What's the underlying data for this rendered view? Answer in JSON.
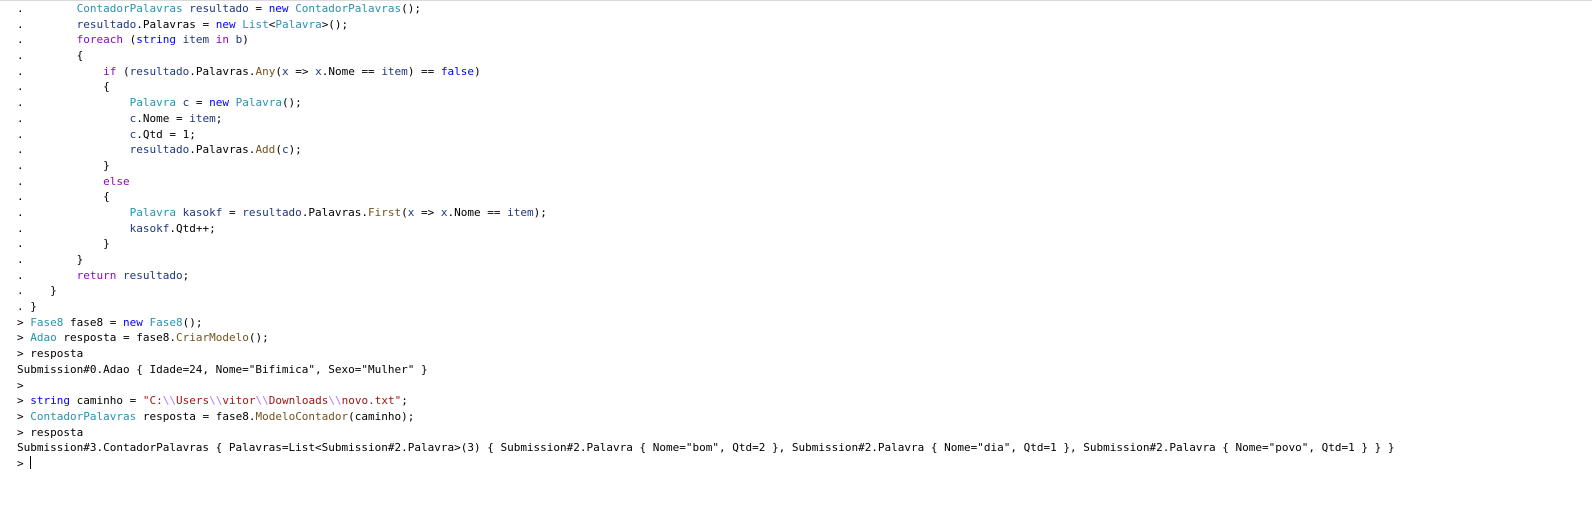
{
  "window": {
    "accent_colors": {
      "keyword": "#0000ff",
      "control_keyword": "#8f08c4",
      "type": "#2b91af",
      "method": "#74531f",
      "parameter": "#1f377f",
      "string": "#a31515",
      "escape": "#b776fb"
    }
  },
  "console": {
    "lines": [
      {
        "kind": "code",
        "tokens": [
          {
            "t": ".",
            "c": "plain"
          },
          {
            "t": "        ",
            "c": "plain"
          },
          {
            "t": "ContadorPalavras",
            "c": "type"
          },
          {
            "t": " ",
            "c": "plain"
          },
          {
            "t": "resultado",
            "c": "param"
          },
          {
            "t": " = ",
            "c": "op"
          },
          {
            "t": "new",
            "c": "kw"
          },
          {
            "t": " ",
            "c": "plain"
          },
          {
            "t": "ContadorPalavras",
            "c": "type"
          },
          {
            "t": "();",
            "c": "op"
          }
        ]
      },
      {
        "kind": "code",
        "tokens": [
          {
            "t": ".",
            "c": "plain"
          },
          {
            "t": "        ",
            "c": "plain"
          },
          {
            "t": "resultado",
            "c": "param"
          },
          {
            "t": ".Palavras = ",
            "c": "op"
          },
          {
            "t": "new",
            "c": "kw"
          },
          {
            "t": " ",
            "c": "plain"
          },
          {
            "t": "List",
            "c": "type"
          },
          {
            "t": "<",
            "c": "op"
          },
          {
            "t": "Palavra",
            "c": "type"
          },
          {
            "t": ">();",
            "c": "op"
          }
        ]
      },
      {
        "kind": "code",
        "tokens": [
          {
            "t": ".",
            "c": "plain"
          },
          {
            "t": "        ",
            "c": "plain"
          },
          {
            "t": "foreach",
            "c": "ctl"
          },
          {
            "t": " (",
            "c": "op"
          },
          {
            "t": "string",
            "c": "kw"
          },
          {
            "t": " ",
            "c": "plain"
          },
          {
            "t": "item",
            "c": "param"
          },
          {
            "t": " ",
            "c": "plain"
          },
          {
            "t": "in",
            "c": "ctl"
          },
          {
            "t": " ",
            "c": "plain"
          },
          {
            "t": "b",
            "c": "param"
          },
          {
            "t": ")",
            "c": "op"
          }
        ]
      },
      {
        "kind": "code",
        "tokens": [
          {
            "t": ".",
            "c": "plain"
          },
          {
            "t": "        {",
            "c": "op"
          }
        ]
      },
      {
        "kind": "code",
        "tokens": [
          {
            "t": ".",
            "c": "plain"
          },
          {
            "t": "            ",
            "c": "plain"
          },
          {
            "t": "if",
            "c": "ctl"
          },
          {
            "t": " (",
            "c": "op"
          },
          {
            "t": "resultado",
            "c": "param"
          },
          {
            "t": ".Palavras.",
            "c": "op"
          },
          {
            "t": "Any",
            "c": "method"
          },
          {
            "t": "(",
            "c": "op"
          },
          {
            "t": "x",
            "c": "param"
          },
          {
            "t": " => ",
            "c": "op"
          },
          {
            "t": "x",
            "c": "param"
          },
          {
            "t": ".Nome == ",
            "c": "op"
          },
          {
            "t": "item",
            "c": "param"
          },
          {
            "t": ") == ",
            "c": "op"
          },
          {
            "t": "false",
            "c": "kw"
          },
          {
            "t": ")",
            "c": "op"
          }
        ]
      },
      {
        "kind": "code",
        "tokens": [
          {
            "t": ".",
            "c": "plain"
          },
          {
            "t": "            {",
            "c": "op"
          }
        ]
      },
      {
        "kind": "code",
        "tokens": [
          {
            "t": ".",
            "c": "plain"
          },
          {
            "t": "                ",
            "c": "plain"
          },
          {
            "t": "Palavra",
            "c": "type"
          },
          {
            "t": " ",
            "c": "plain"
          },
          {
            "t": "c",
            "c": "param"
          },
          {
            "t": " = ",
            "c": "op"
          },
          {
            "t": "new",
            "c": "kw"
          },
          {
            "t": " ",
            "c": "plain"
          },
          {
            "t": "Palavra",
            "c": "type"
          },
          {
            "t": "();",
            "c": "op"
          }
        ]
      },
      {
        "kind": "code",
        "tokens": [
          {
            "t": ".",
            "c": "plain"
          },
          {
            "t": "                ",
            "c": "plain"
          },
          {
            "t": "c",
            "c": "param"
          },
          {
            "t": ".Nome = ",
            "c": "op"
          },
          {
            "t": "item",
            "c": "param"
          },
          {
            "t": ";",
            "c": "op"
          }
        ]
      },
      {
        "kind": "code",
        "tokens": [
          {
            "t": ".",
            "c": "plain"
          },
          {
            "t": "                ",
            "c": "plain"
          },
          {
            "t": "c",
            "c": "param"
          },
          {
            "t": ".Qtd = 1;",
            "c": "op"
          }
        ]
      },
      {
        "kind": "code",
        "tokens": [
          {
            "t": ".",
            "c": "plain"
          },
          {
            "t": "                ",
            "c": "plain"
          },
          {
            "t": "resultado",
            "c": "param"
          },
          {
            "t": ".Palavras.",
            "c": "op"
          },
          {
            "t": "Add",
            "c": "method"
          },
          {
            "t": "(",
            "c": "op"
          },
          {
            "t": "c",
            "c": "param"
          },
          {
            "t": ");",
            "c": "op"
          }
        ]
      },
      {
        "kind": "code",
        "tokens": [
          {
            "t": ".",
            "c": "plain"
          },
          {
            "t": "            }",
            "c": "op"
          }
        ]
      },
      {
        "kind": "code",
        "tokens": [
          {
            "t": ".",
            "c": "plain"
          },
          {
            "t": "            ",
            "c": "plain"
          },
          {
            "t": "else",
            "c": "ctl"
          }
        ]
      },
      {
        "kind": "code",
        "tokens": [
          {
            "t": ".",
            "c": "plain"
          },
          {
            "t": "            {",
            "c": "op"
          }
        ]
      },
      {
        "kind": "code",
        "tokens": [
          {
            "t": ".",
            "c": "plain"
          },
          {
            "t": "                ",
            "c": "plain"
          },
          {
            "t": "Palavra",
            "c": "type"
          },
          {
            "t": " ",
            "c": "plain"
          },
          {
            "t": "kasokf",
            "c": "param"
          },
          {
            "t": " = ",
            "c": "op"
          },
          {
            "t": "resultado",
            "c": "param"
          },
          {
            "t": ".Palavras.",
            "c": "op"
          },
          {
            "t": "First",
            "c": "method"
          },
          {
            "t": "(",
            "c": "op"
          },
          {
            "t": "x",
            "c": "param"
          },
          {
            "t": " => ",
            "c": "op"
          },
          {
            "t": "x",
            "c": "param"
          },
          {
            "t": ".Nome == ",
            "c": "op"
          },
          {
            "t": "item",
            "c": "param"
          },
          {
            "t": ");",
            "c": "op"
          }
        ]
      },
      {
        "kind": "code",
        "tokens": [
          {
            "t": ".",
            "c": "plain"
          },
          {
            "t": "                ",
            "c": "plain"
          },
          {
            "t": "kasokf",
            "c": "param"
          },
          {
            "t": ".Qtd++;",
            "c": "op"
          }
        ]
      },
      {
        "kind": "code",
        "tokens": [
          {
            "t": ".",
            "c": "plain"
          },
          {
            "t": "            }",
            "c": "op"
          }
        ]
      },
      {
        "kind": "code",
        "tokens": [
          {
            "t": ".",
            "c": "plain"
          },
          {
            "t": "        }",
            "c": "op"
          }
        ]
      },
      {
        "kind": "code",
        "tokens": [
          {
            "t": ".",
            "c": "plain"
          },
          {
            "t": "        ",
            "c": "plain"
          },
          {
            "t": "return",
            "c": "ctl"
          },
          {
            "t": " ",
            "c": "plain"
          },
          {
            "t": "resultado",
            "c": "param"
          },
          {
            "t": ";",
            "c": "op"
          }
        ]
      },
      {
        "kind": "code",
        "tokens": [
          {
            "t": ".",
            "c": "plain"
          },
          {
            "t": "    }",
            "c": "op"
          }
        ]
      },
      {
        "kind": "code",
        "tokens": [
          {
            "t": ". }",
            "c": "op"
          }
        ]
      },
      {
        "kind": "input",
        "tokens": [
          {
            "t": "> ",
            "c": "plain"
          },
          {
            "t": "Fase8",
            "c": "type"
          },
          {
            "t": " ",
            "c": "plain"
          },
          {
            "t": "fase8",
            "c": "plain"
          },
          {
            "t": " = ",
            "c": "op"
          },
          {
            "t": "new",
            "c": "kw"
          },
          {
            "t": " ",
            "c": "plain"
          },
          {
            "t": "Fase8",
            "c": "type"
          },
          {
            "t": "();",
            "c": "op"
          }
        ]
      },
      {
        "kind": "input",
        "tokens": [
          {
            "t": "> ",
            "c": "plain"
          },
          {
            "t": "Adao",
            "c": "type"
          },
          {
            "t": " ",
            "c": "plain"
          },
          {
            "t": "resposta",
            "c": "plain"
          },
          {
            "t": " = ",
            "c": "op"
          },
          {
            "t": "fase8",
            "c": "plain"
          },
          {
            "t": ".",
            "c": "op"
          },
          {
            "t": "CriarModelo",
            "c": "method"
          },
          {
            "t": "();",
            "c": "op"
          }
        ]
      },
      {
        "kind": "input",
        "tokens": [
          {
            "t": "> ",
            "c": "plain"
          },
          {
            "t": "resposta",
            "c": "plain"
          }
        ]
      },
      {
        "kind": "output",
        "tokens": [
          {
            "t": "Submission#0.Adao { Idade=24, Nome=\"Bifimica\", Sexo=\"Mulher\" }",
            "c": "plain"
          }
        ]
      },
      {
        "kind": "input",
        "tokens": [
          {
            "t": ">",
            "c": "plain"
          }
        ]
      },
      {
        "kind": "input",
        "tokens": [
          {
            "t": "> ",
            "c": "plain"
          },
          {
            "t": "string",
            "c": "kw"
          },
          {
            "t": " ",
            "c": "plain"
          },
          {
            "t": "caminho",
            "c": "plain"
          },
          {
            "t": " = ",
            "c": "op"
          },
          {
            "t": "\"C:",
            "c": "str"
          },
          {
            "t": "\\\\",
            "c": "esc"
          },
          {
            "t": "Users",
            "c": "str"
          },
          {
            "t": "\\\\",
            "c": "esc"
          },
          {
            "t": "vitor",
            "c": "str"
          },
          {
            "t": "\\\\",
            "c": "esc"
          },
          {
            "t": "Downloads",
            "c": "str"
          },
          {
            "t": "\\\\",
            "c": "esc"
          },
          {
            "t": "novo.txt\"",
            "c": "str"
          },
          {
            "t": ";",
            "c": "op"
          }
        ]
      },
      {
        "kind": "input",
        "tokens": [
          {
            "t": "> ",
            "c": "plain"
          },
          {
            "t": "ContadorPalavras",
            "c": "type"
          },
          {
            "t": " ",
            "c": "plain"
          },
          {
            "t": "resposta",
            "c": "plain"
          },
          {
            "t": " = ",
            "c": "op"
          },
          {
            "t": "fase8",
            "c": "plain"
          },
          {
            "t": ".",
            "c": "op"
          },
          {
            "t": "ModeloContador",
            "c": "method"
          },
          {
            "t": "(",
            "c": "op"
          },
          {
            "t": "caminho",
            "c": "plain"
          },
          {
            "t": ");",
            "c": "op"
          }
        ]
      },
      {
        "kind": "input",
        "tokens": [
          {
            "t": "> ",
            "c": "plain"
          },
          {
            "t": "resposta",
            "c": "plain"
          }
        ]
      },
      {
        "kind": "output",
        "tokens": [
          {
            "t": "Submission#3.ContadorPalavras { Palavras=List<Submission#2.Palavra>(3) { Submission#2.Palavra { Nome=\"bom\", Qtd=2 }, Submission#2.Palavra { Nome=\"dia\", Qtd=1 }, Submission#2.Palavra { Nome=\"povo\", Qtd=1 } } }",
            "c": "plain"
          }
        ]
      },
      {
        "kind": "prompt",
        "tokens": [
          {
            "t": "> ",
            "c": "plain"
          }
        ]
      }
    ]
  }
}
